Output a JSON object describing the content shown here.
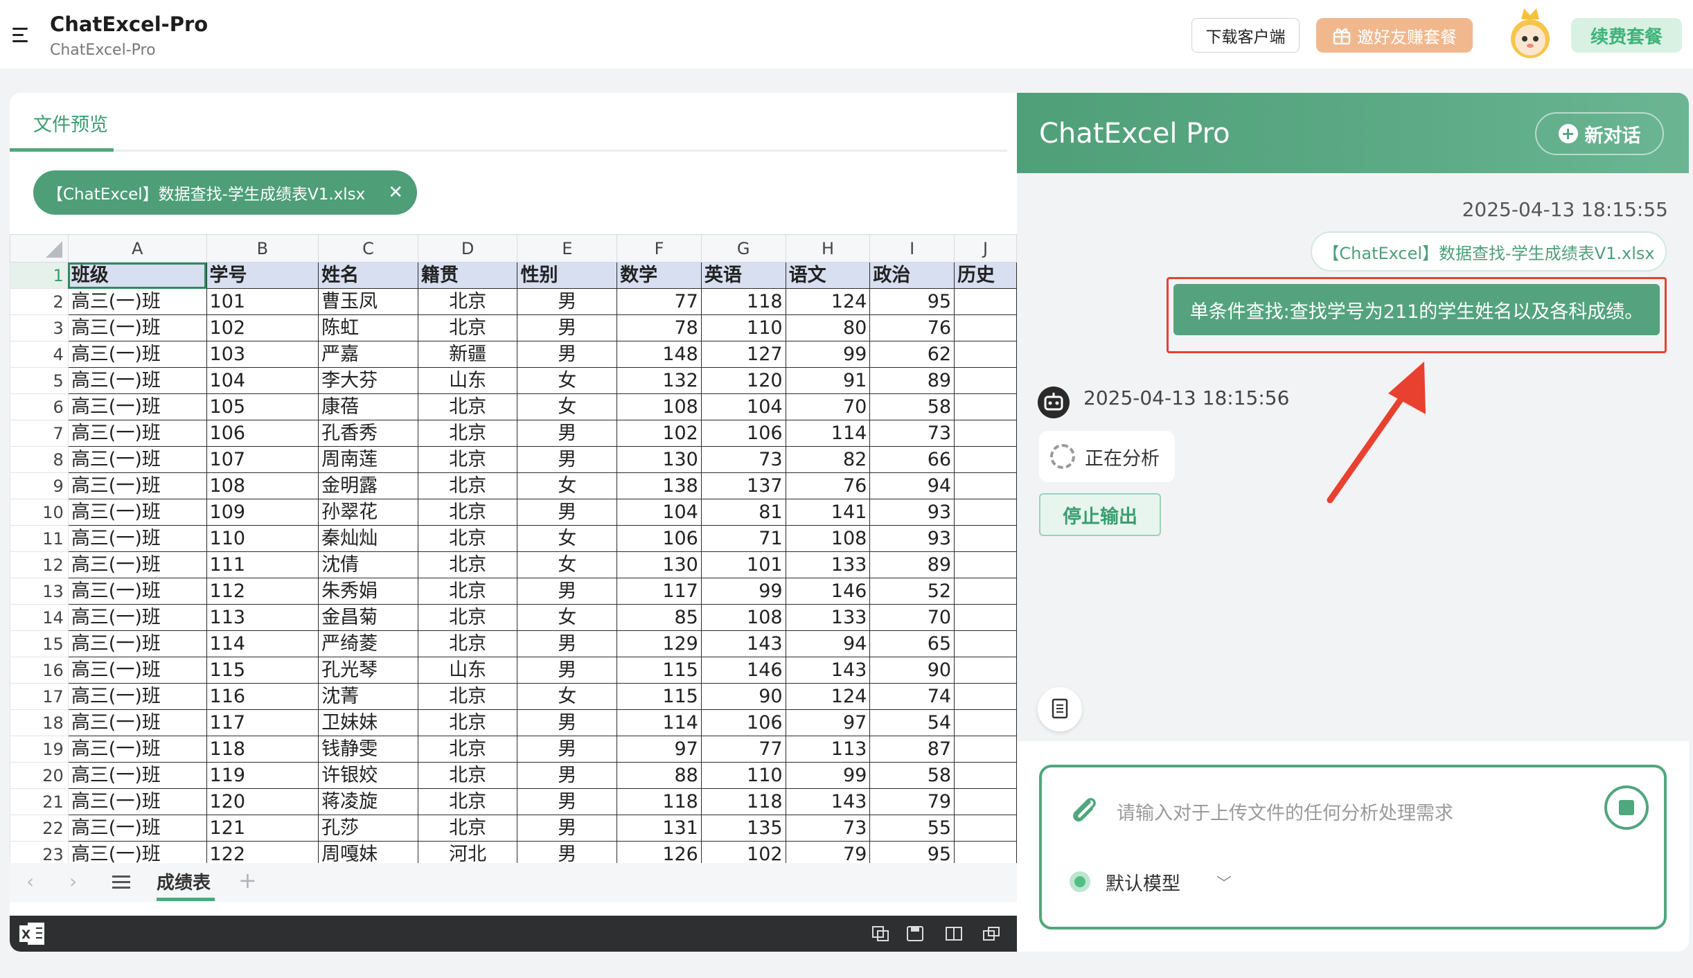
{
  "header": {
    "app_title": "ChatExcel-Pro",
    "app_subtitle": "ChatExcel-Pro",
    "download_label": "下载客户端",
    "invite_label": "邀好友赚套餐",
    "renew_label": "续费套餐",
    "colors": {
      "accent": "#4fa77d",
      "invite_bg": "#f1b88d"
    }
  },
  "preview": {
    "tab_label": "文件预览",
    "file_pill": "【ChatExcel】数据查找-学生成绩表V1.xlsx",
    "sheet_tab": "成绩表",
    "columns": [
      "A",
      "B",
      "C",
      "D",
      "E",
      "F",
      "G",
      "H",
      "I",
      "J"
    ],
    "header_row": [
      "班级",
      "学号",
      "姓名",
      "籍贯",
      "性别",
      "数学",
      "英语",
      "语文",
      "政治",
      "历史"
    ],
    "rows": [
      [
        "高三(一)班",
        "101",
        "曹玉凤",
        "北京",
        "男",
        "77",
        "118",
        "124",
        "95",
        ""
      ],
      [
        "高三(一)班",
        "102",
        "陈虹",
        "北京",
        "男",
        "78",
        "110",
        "80",
        "76",
        ""
      ],
      [
        "高三(一)班",
        "103",
        "严嘉",
        "新疆",
        "男",
        "148",
        "127",
        "99",
        "62",
        ""
      ],
      [
        "高三(一)班",
        "104",
        "李大芬",
        "山东",
        "女",
        "132",
        "120",
        "91",
        "89",
        ""
      ],
      [
        "高三(一)班",
        "105",
        "康蓓",
        "北京",
        "女",
        "108",
        "104",
        "70",
        "58",
        ""
      ],
      [
        "高三(一)班",
        "106",
        "孔香秀",
        "北京",
        "男",
        "102",
        "106",
        "114",
        "73",
        ""
      ],
      [
        "高三(一)班",
        "107",
        "周南莲",
        "北京",
        "男",
        "130",
        "73",
        "82",
        "66",
        ""
      ],
      [
        "高三(一)班",
        "108",
        "金明露",
        "北京",
        "女",
        "138",
        "137",
        "76",
        "94",
        ""
      ],
      [
        "高三(一)班",
        "109",
        "孙翠花",
        "北京",
        "男",
        "104",
        "81",
        "141",
        "93",
        ""
      ],
      [
        "高三(一)班",
        "110",
        "秦灿灿",
        "北京",
        "女",
        "106",
        "71",
        "108",
        "93",
        ""
      ],
      [
        "高三(一)班",
        "111",
        "沈倩",
        "北京",
        "女",
        "130",
        "101",
        "133",
        "89",
        ""
      ],
      [
        "高三(一)班",
        "112",
        "朱秀娟",
        "北京",
        "男",
        "117",
        "99",
        "146",
        "52",
        ""
      ],
      [
        "高三(一)班",
        "113",
        "金昌菊",
        "北京",
        "女",
        "85",
        "108",
        "133",
        "70",
        ""
      ],
      [
        "高三(一)班",
        "114",
        "严绮菱",
        "北京",
        "男",
        "129",
        "143",
        "94",
        "65",
        ""
      ],
      [
        "高三(一)班",
        "115",
        "孔光琴",
        "山东",
        "男",
        "115",
        "146",
        "143",
        "90",
        ""
      ],
      [
        "高三(一)班",
        "116",
        "沈菁",
        "北京",
        "女",
        "115",
        "90",
        "124",
        "74",
        ""
      ],
      [
        "高三(一)班",
        "117",
        "卫妹妹",
        "北京",
        "男",
        "114",
        "106",
        "97",
        "54",
        ""
      ],
      [
        "高三(一)班",
        "118",
        "钱静雯",
        "北京",
        "男",
        "97",
        "77",
        "113",
        "87",
        ""
      ],
      [
        "高三(一)班",
        "119",
        "许银姣",
        "北京",
        "男",
        "88",
        "110",
        "99",
        "58",
        ""
      ],
      [
        "高三(一)班",
        "120",
        "蒋凌旋",
        "北京",
        "男",
        "118",
        "118",
        "143",
        "79",
        ""
      ],
      [
        "高三(一)班",
        "121",
        "孔莎",
        "北京",
        "男",
        "131",
        "135",
        "73",
        "55",
        ""
      ],
      [
        "高三(一)班",
        "122",
        "周嘎妹",
        "河北",
        "男",
        "126",
        "102",
        "79",
        "95",
        ""
      ]
    ]
  },
  "chat": {
    "title": "ChatExcel Pro",
    "new_chat_label": "新对话",
    "user_timestamp": "2025-04-13 18:15:55",
    "attached_file": "【ChatExcel】数据查找-学生成绩表V1.xlsx",
    "user_message": "单条件查找:查找学号为211的学生姓名以及各科成绩。",
    "bot_timestamp": "2025-04-13 18:15:56",
    "status_text": "正在分析",
    "stop_label": "停止输出",
    "input_placeholder": "请输入对于上传文件的任何分析处理需求",
    "model_label": "默认模型",
    "highlight_color": "#e8412f"
  }
}
